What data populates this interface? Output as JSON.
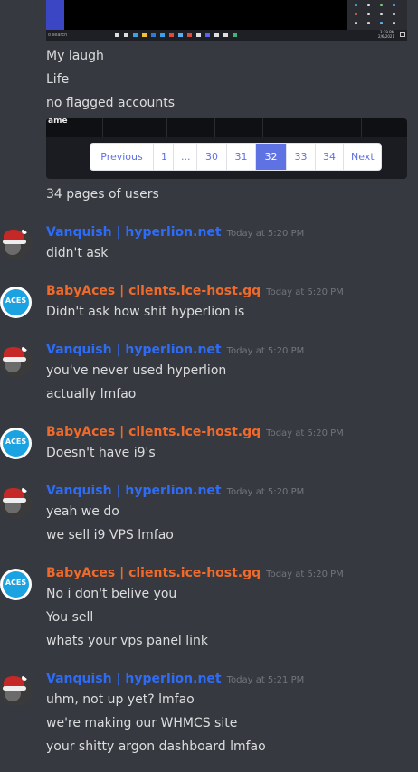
{
  "screenshot": {
    "taskbar_search": "o search",
    "clock_time": "3:39 PM",
    "clock_date": "2/6/2021"
  },
  "early_messages": [
    "My laugh",
    "Life",
    "no flagged accounts"
  ],
  "table_header": "ame",
  "pagination": {
    "items": [
      "Previous",
      "1",
      "...",
      "30",
      "31",
      "32",
      "33",
      "34",
      "Next"
    ],
    "active": "32"
  },
  "pages_caption": "34 pages of users",
  "messages": [
    {
      "author": "Vanquish | hyperlion.net",
      "timestamp": "Today at 5:20 PM",
      "lines": [
        "didn't ask"
      ]
    },
    {
      "author": "BabyAces | clients.ice-host.gq",
      "timestamp": "Today at 5:20 PM",
      "lines": [
        "Didn't ask how shit hyperlion is"
      ]
    },
    {
      "author": "Vanquish | hyperlion.net",
      "timestamp": "Today at 5:20 PM",
      "lines": [
        "you've never used hyperlion",
        "actually lmfao"
      ]
    },
    {
      "author": "BabyAces | clients.ice-host.gq",
      "timestamp": "Today at 5:20 PM",
      "lines": [
        "Doesn't have i9's"
      ]
    },
    {
      "author": "Vanquish | hyperlion.net",
      "timestamp": "Today at 5:20 PM",
      "lines": [
        "yeah we do",
        "we sell i9 VPS lmfao"
      ]
    },
    {
      "author": "BabyAces | clients.ice-host.gq",
      "timestamp": "Today at 5:20 PM",
      "lines": [
        "No i don't belive you",
        "You sell",
        "whats your vps panel link"
      ]
    },
    {
      "author": "Vanquish | hyperlion.net",
      "timestamp": "Today at 5:21 PM",
      "lines": [
        "uhm, not up yet? lmfao",
        "we're making our WHMCS site",
        "your shitty argon dashboard lmfao"
      ]
    }
  ],
  "avatar_text": "ACES",
  "colors": {
    "background": "#36393f",
    "vanquish": "#2f6cf6",
    "babyaces": "#f06a2b",
    "timestamp": "#72767d",
    "pagination_active": "#5e72e4"
  }
}
